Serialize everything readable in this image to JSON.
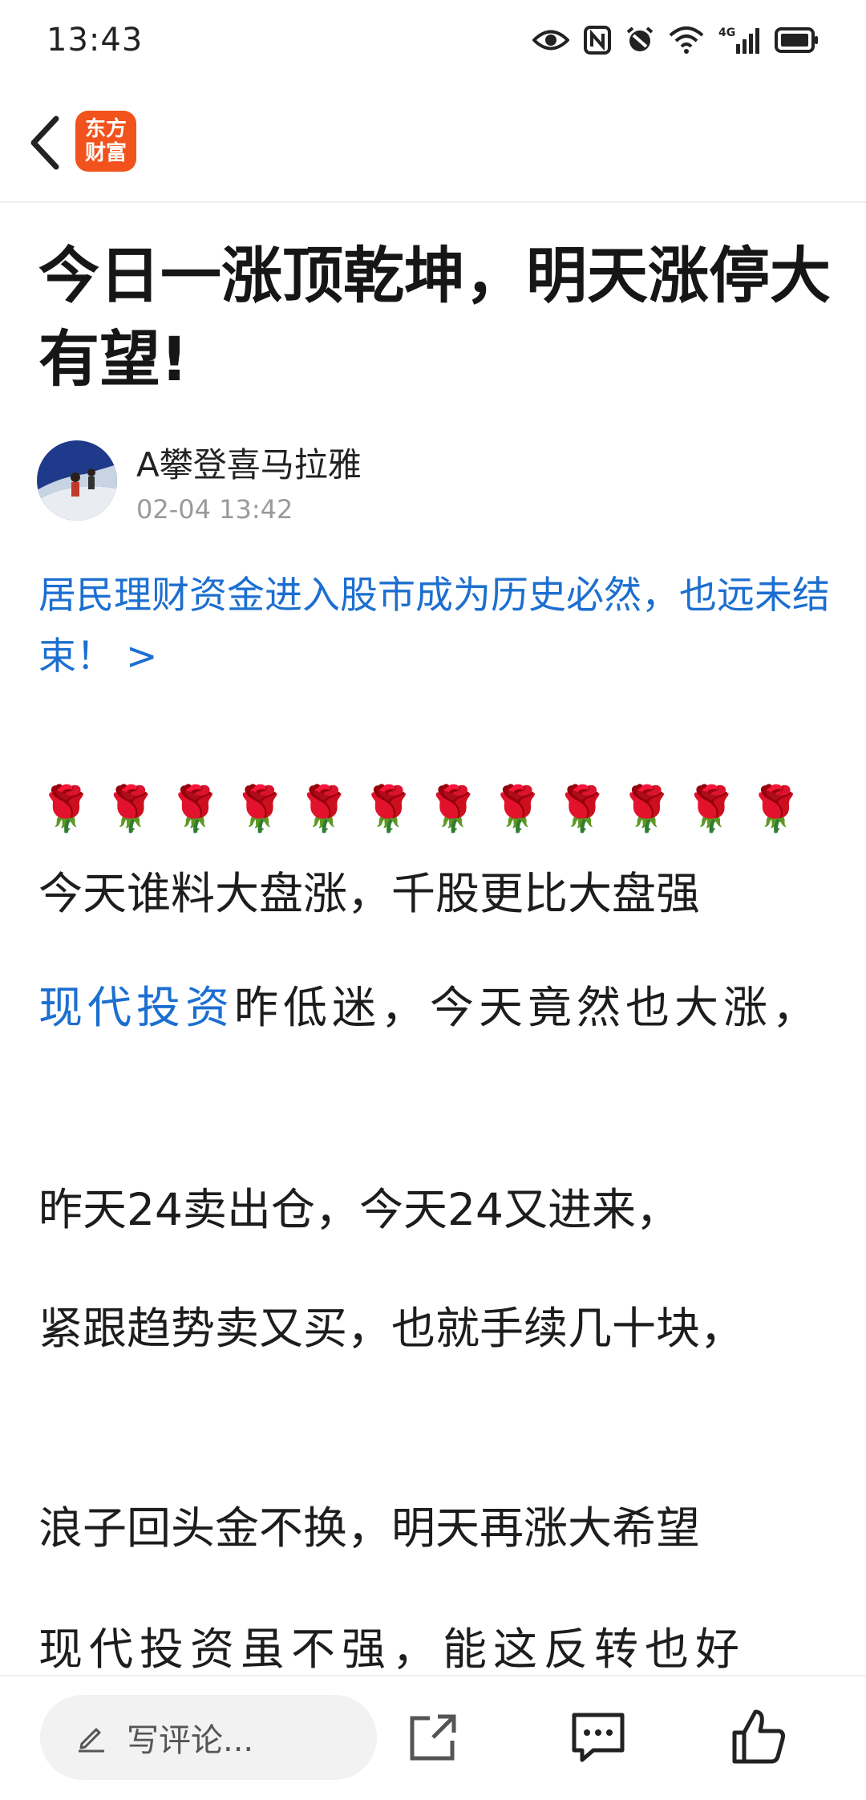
{
  "status_bar": {
    "time": "13:43",
    "network": "4G",
    "icons": [
      "eye-icon",
      "nfc-icon",
      "alarm-icon",
      "wifi-icon",
      "signal-icon",
      "battery-icon"
    ]
  },
  "nav": {
    "back_icon": "chevron-left-icon",
    "logo_line1": "东方",
    "logo_line2": "财富",
    "logo_color": "#f2521c"
  },
  "article": {
    "title": "今日一涨顶乾坤，明天涨停大有望!",
    "author": "A攀登喜马拉雅",
    "time": "02-04 13:42",
    "related_link": "居民理财资金进入股市成为历史必然，也远未结束！ >",
    "roses": "🌹🌹🌹🌹🌹🌹🌹🌹🌹🌹🌹🌹",
    "line1_after_roses": " 今天谁料大盘涨，千股更比大盘强",
    "stock_name": "现代投资",
    "line2_rest": "昨低迷，今天竟然也大涨，",
    "line3": "昨天24卖出仓，今天24又进来，",
    "line4": "紧跟趋势卖又买，也就手续几十块，",
    "line5": "浪子回头金不换，明天再涨大希望",
    "line6": "现代投资虽不强，能这反转也好"
  },
  "bottom_bar": {
    "comment_placeholder": "写评论...",
    "icons": [
      "pen-icon",
      "share-icon",
      "comments-icon",
      "like-icon"
    ]
  },
  "colors": {
    "link": "#1c6fd0",
    "brand": "#f2521c"
  }
}
